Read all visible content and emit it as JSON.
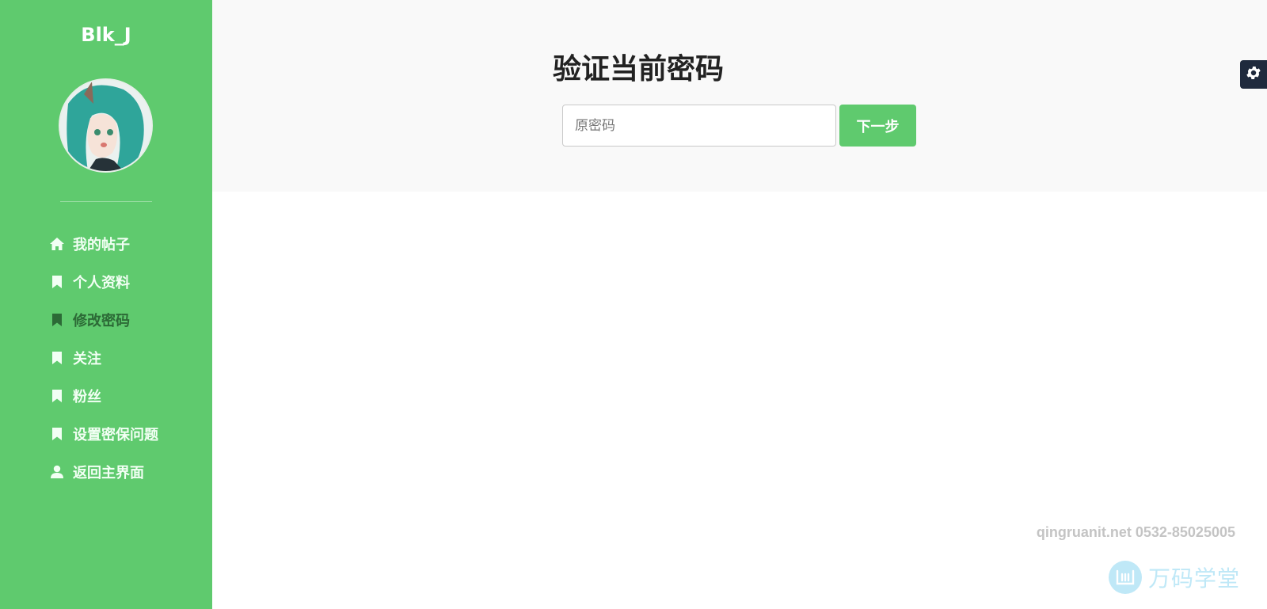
{
  "sidebar": {
    "username": "Blk_J",
    "items": [
      {
        "label": "我的帖子",
        "icon": "home-icon",
        "active": false
      },
      {
        "label": "个人资料",
        "icon": "bookmark-icon",
        "active": false
      },
      {
        "label": "修改密码",
        "icon": "bookmark-icon",
        "active": true
      },
      {
        "label": "关注",
        "icon": "bookmark-icon",
        "active": false
      },
      {
        "label": "粉丝",
        "icon": "bookmark-icon",
        "active": false
      },
      {
        "label": "设置密保问题",
        "icon": "bookmark-icon",
        "active": false
      },
      {
        "label": "返回主界面",
        "icon": "user-icon",
        "active": false
      }
    ]
  },
  "main": {
    "title": "验证当前密码",
    "password_placeholder": "原密码",
    "password_value": "",
    "next_label": "下一步"
  },
  "watermark": {
    "line": "qingruanit.net 0532-85025005",
    "logo_text": "万码学堂"
  },
  "colors": {
    "accent": "#5fca6e",
    "active_nav": "#2c6a36",
    "settings_tab": "#1f2a3d",
    "panel_bg": "#f9f9f9"
  }
}
